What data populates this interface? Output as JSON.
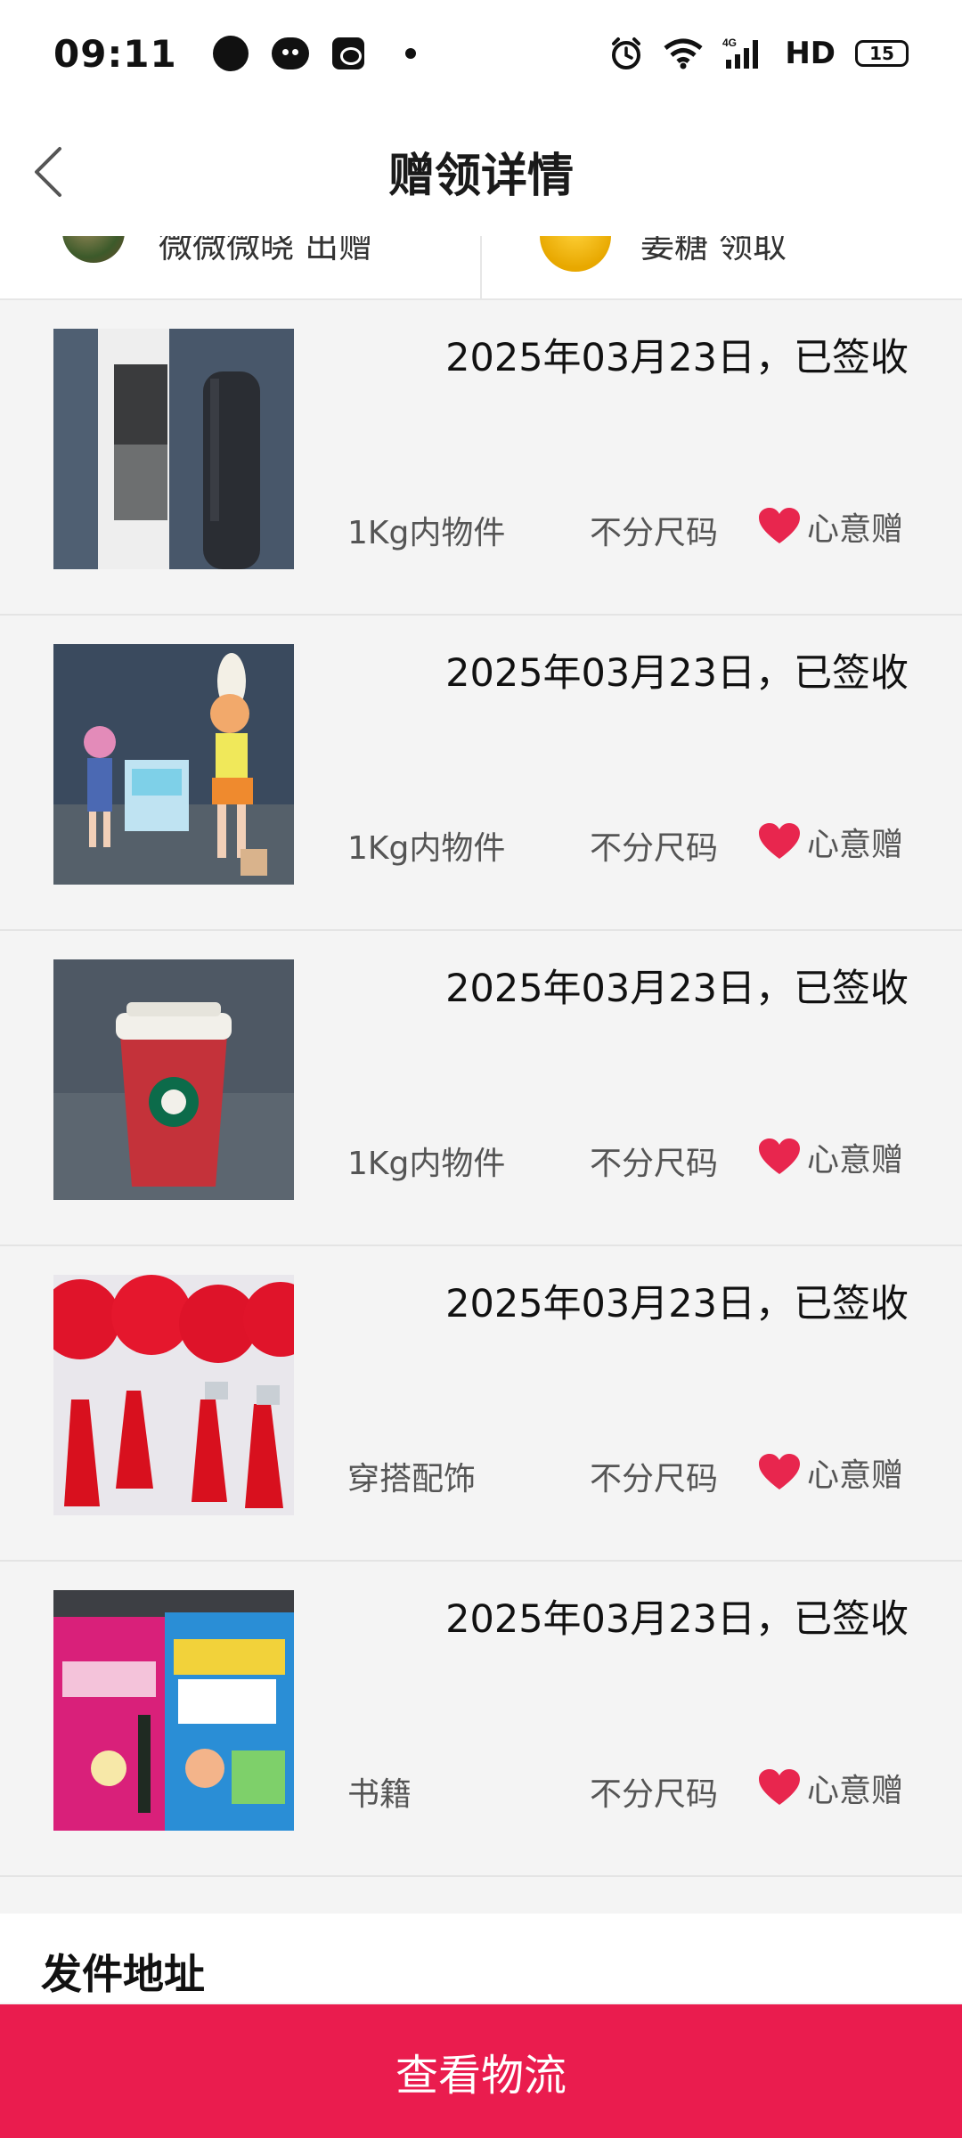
{
  "status_bar": {
    "time": "09:11",
    "network": "4G",
    "hd": "HD",
    "battery": "15"
  },
  "header": {
    "title": "赠领详情"
  },
  "givers": {
    "left_text": "微微微晓 出赠",
    "right_text": "姜糖 领取"
  },
  "gifts": [
    {
      "date": "2025年03月23日，已签收",
      "category": "1Kg内物件",
      "size": "不分尺码",
      "tag": "心意赠",
      "thumb": "thermos-black"
    },
    {
      "date": "2025年03月23日，已签收",
      "category": "1Kg内物件",
      "size": "不分尺码",
      "tag": "心意赠",
      "thumb": "anime-figures"
    },
    {
      "date": "2025年03月23日，已签收",
      "category": "1Kg内物件",
      "size": "不分尺码",
      "tag": "心意赠",
      "thumb": "starbucks-cup"
    },
    {
      "date": "2025年03月23日，已签收",
      "category": "穿搭配饰",
      "size": "不分尺码",
      "tag": "心意赠",
      "thumb": "red-tassels"
    },
    {
      "date": "2025年03月23日，已签收",
      "category": "书籍",
      "size": "不分尺码",
      "tag": "心意赠",
      "thumb": "kids-books"
    }
  ],
  "address": {
    "title": "发件地址"
  },
  "footer": {
    "button_label": "查看物流"
  },
  "colors": {
    "accent": "#ea1c4e",
    "heart": "#e8264e",
    "background": "#f4f4f4"
  }
}
